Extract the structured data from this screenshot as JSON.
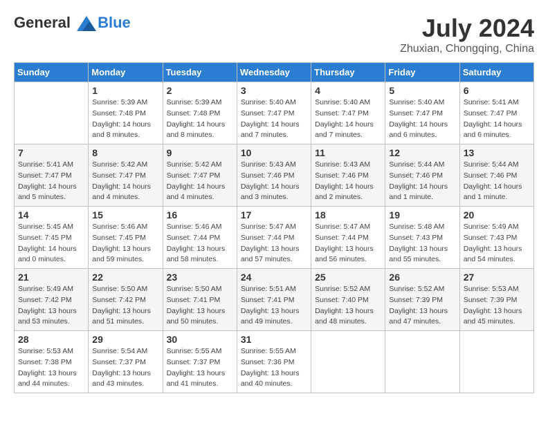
{
  "logo": {
    "line1": "General",
    "line2": "Blue"
  },
  "header": {
    "month_year": "July 2024",
    "location": "Zhuxian, Chongqing, China"
  },
  "weekdays": [
    "Sunday",
    "Monday",
    "Tuesday",
    "Wednesday",
    "Thursday",
    "Friday",
    "Saturday"
  ],
  "weeks": [
    [
      {
        "day": "",
        "sunrise": "",
        "sunset": "",
        "daylight": ""
      },
      {
        "day": "1",
        "sunrise": "Sunrise: 5:39 AM",
        "sunset": "Sunset: 7:48 PM",
        "daylight": "Daylight: 14 hours and 8 minutes."
      },
      {
        "day": "2",
        "sunrise": "Sunrise: 5:39 AM",
        "sunset": "Sunset: 7:48 PM",
        "daylight": "Daylight: 14 hours and 8 minutes."
      },
      {
        "day": "3",
        "sunrise": "Sunrise: 5:40 AM",
        "sunset": "Sunset: 7:47 PM",
        "daylight": "Daylight: 14 hours and 7 minutes."
      },
      {
        "day": "4",
        "sunrise": "Sunrise: 5:40 AM",
        "sunset": "Sunset: 7:47 PM",
        "daylight": "Daylight: 14 hours and 7 minutes."
      },
      {
        "day": "5",
        "sunrise": "Sunrise: 5:40 AM",
        "sunset": "Sunset: 7:47 PM",
        "daylight": "Daylight: 14 hours and 6 minutes."
      },
      {
        "day": "6",
        "sunrise": "Sunrise: 5:41 AM",
        "sunset": "Sunset: 7:47 PM",
        "daylight": "Daylight: 14 hours and 6 minutes."
      }
    ],
    [
      {
        "day": "7",
        "sunrise": "Sunrise: 5:41 AM",
        "sunset": "Sunset: 7:47 PM",
        "daylight": "Daylight: 14 hours and 5 minutes."
      },
      {
        "day": "8",
        "sunrise": "Sunrise: 5:42 AM",
        "sunset": "Sunset: 7:47 PM",
        "daylight": "Daylight: 14 hours and 4 minutes."
      },
      {
        "day": "9",
        "sunrise": "Sunrise: 5:42 AM",
        "sunset": "Sunset: 7:47 PM",
        "daylight": "Daylight: 14 hours and 4 minutes."
      },
      {
        "day": "10",
        "sunrise": "Sunrise: 5:43 AM",
        "sunset": "Sunset: 7:46 PM",
        "daylight": "Daylight: 14 hours and 3 minutes."
      },
      {
        "day": "11",
        "sunrise": "Sunrise: 5:43 AM",
        "sunset": "Sunset: 7:46 PM",
        "daylight": "Daylight: 14 hours and 2 minutes."
      },
      {
        "day": "12",
        "sunrise": "Sunrise: 5:44 AM",
        "sunset": "Sunset: 7:46 PM",
        "daylight": "Daylight: 14 hours and 1 minute."
      },
      {
        "day": "13",
        "sunrise": "Sunrise: 5:44 AM",
        "sunset": "Sunset: 7:46 PM",
        "daylight": "Daylight: 14 hours and 1 minute."
      }
    ],
    [
      {
        "day": "14",
        "sunrise": "Sunrise: 5:45 AM",
        "sunset": "Sunset: 7:45 PM",
        "daylight": "Daylight: 14 hours and 0 minutes."
      },
      {
        "day": "15",
        "sunrise": "Sunrise: 5:46 AM",
        "sunset": "Sunset: 7:45 PM",
        "daylight": "Daylight: 13 hours and 59 minutes."
      },
      {
        "day": "16",
        "sunrise": "Sunrise: 5:46 AM",
        "sunset": "Sunset: 7:44 PM",
        "daylight": "Daylight: 13 hours and 58 minutes."
      },
      {
        "day": "17",
        "sunrise": "Sunrise: 5:47 AM",
        "sunset": "Sunset: 7:44 PM",
        "daylight": "Daylight: 13 hours and 57 minutes."
      },
      {
        "day": "18",
        "sunrise": "Sunrise: 5:47 AM",
        "sunset": "Sunset: 7:44 PM",
        "daylight": "Daylight: 13 hours and 56 minutes."
      },
      {
        "day": "19",
        "sunrise": "Sunrise: 5:48 AM",
        "sunset": "Sunset: 7:43 PM",
        "daylight": "Daylight: 13 hours and 55 minutes."
      },
      {
        "day": "20",
        "sunrise": "Sunrise: 5:49 AM",
        "sunset": "Sunset: 7:43 PM",
        "daylight": "Daylight: 13 hours and 54 minutes."
      }
    ],
    [
      {
        "day": "21",
        "sunrise": "Sunrise: 5:49 AM",
        "sunset": "Sunset: 7:42 PM",
        "daylight": "Daylight: 13 hours and 53 minutes."
      },
      {
        "day": "22",
        "sunrise": "Sunrise: 5:50 AM",
        "sunset": "Sunset: 7:42 PM",
        "daylight": "Daylight: 13 hours and 51 minutes."
      },
      {
        "day": "23",
        "sunrise": "Sunrise: 5:50 AM",
        "sunset": "Sunset: 7:41 PM",
        "daylight": "Daylight: 13 hours and 50 minutes."
      },
      {
        "day": "24",
        "sunrise": "Sunrise: 5:51 AM",
        "sunset": "Sunset: 7:41 PM",
        "daylight": "Daylight: 13 hours and 49 minutes."
      },
      {
        "day": "25",
        "sunrise": "Sunrise: 5:52 AM",
        "sunset": "Sunset: 7:40 PM",
        "daylight": "Daylight: 13 hours and 48 minutes."
      },
      {
        "day": "26",
        "sunrise": "Sunrise: 5:52 AM",
        "sunset": "Sunset: 7:39 PM",
        "daylight": "Daylight: 13 hours and 47 minutes."
      },
      {
        "day": "27",
        "sunrise": "Sunrise: 5:53 AM",
        "sunset": "Sunset: 7:39 PM",
        "daylight": "Daylight: 13 hours and 45 minutes."
      }
    ],
    [
      {
        "day": "28",
        "sunrise": "Sunrise: 5:53 AM",
        "sunset": "Sunset: 7:38 PM",
        "daylight": "Daylight: 13 hours and 44 minutes."
      },
      {
        "day": "29",
        "sunrise": "Sunrise: 5:54 AM",
        "sunset": "Sunset: 7:37 PM",
        "daylight": "Daylight: 13 hours and 43 minutes."
      },
      {
        "day": "30",
        "sunrise": "Sunrise: 5:55 AM",
        "sunset": "Sunset: 7:37 PM",
        "daylight": "Daylight: 13 hours and 41 minutes."
      },
      {
        "day": "31",
        "sunrise": "Sunrise: 5:55 AM",
        "sunset": "Sunset: 7:36 PM",
        "daylight": "Daylight: 13 hours and 40 minutes."
      },
      {
        "day": "",
        "sunrise": "",
        "sunset": "",
        "daylight": ""
      },
      {
        "day": "",
        "sunrise": "",
        "sunset": "",
        "daylight": ""
      },
      {
        "day": "",
        "sunrise": "",
        "sunset": "",
        "daylight": ""
      }
    ]
  ]
}
